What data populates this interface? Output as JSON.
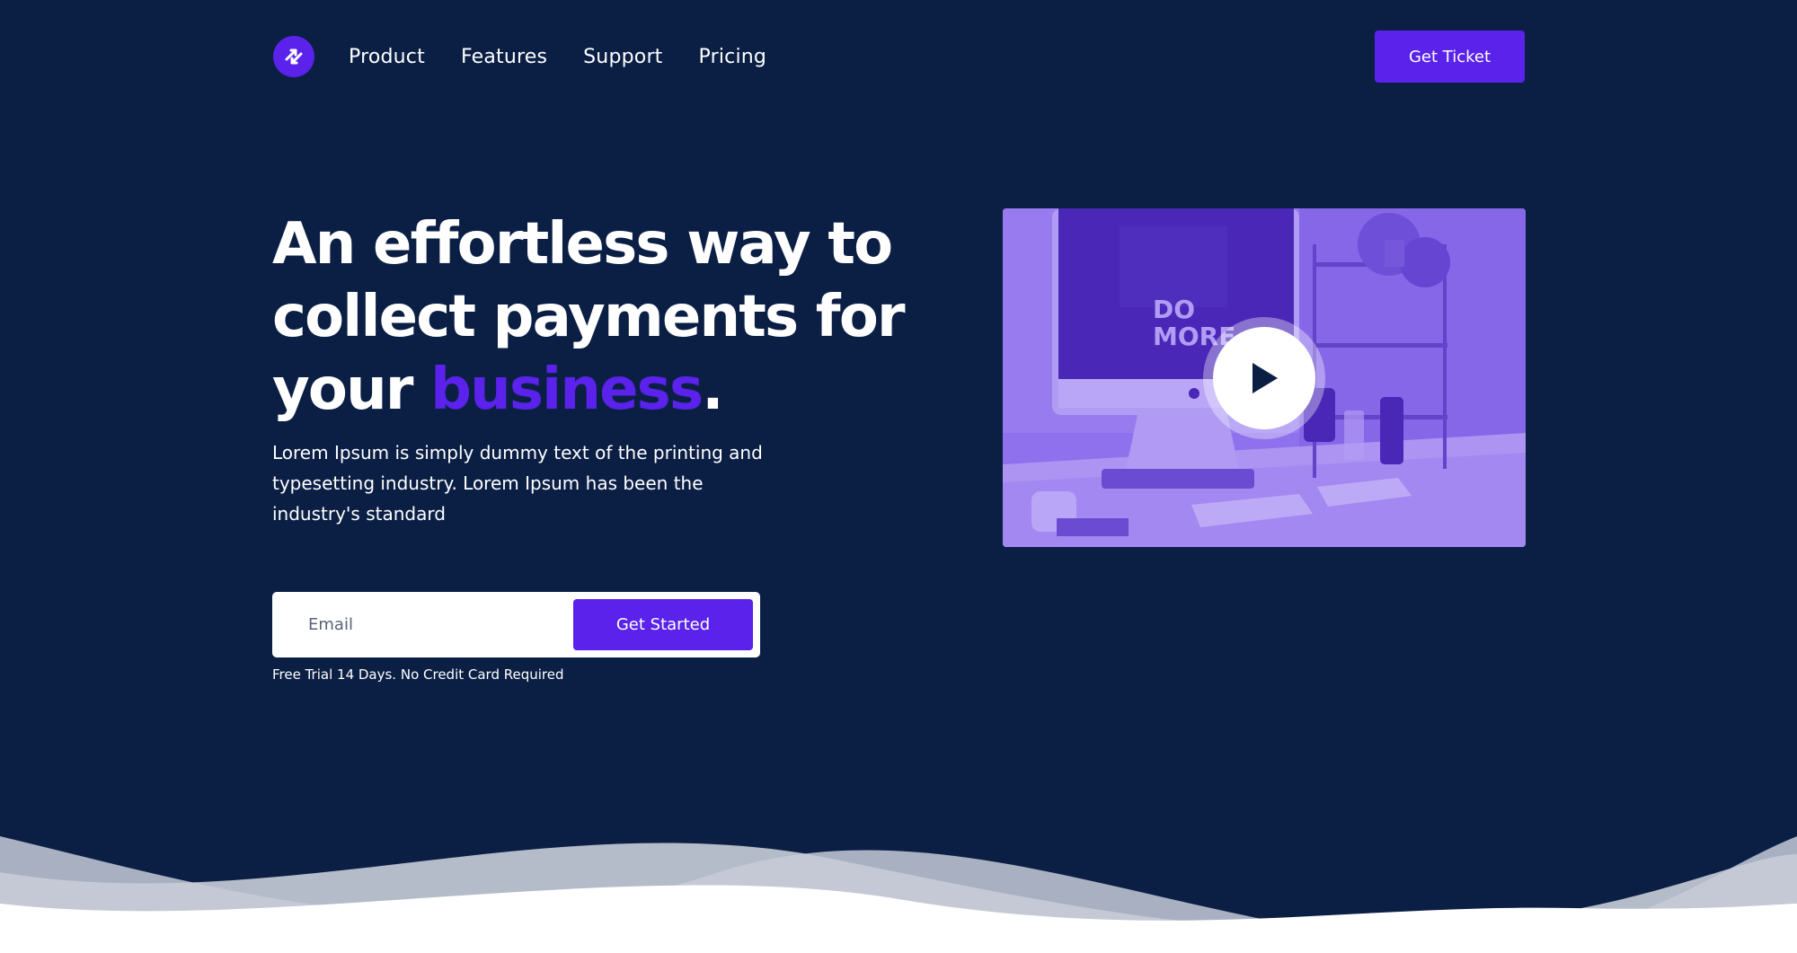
{
  "header": {
    "logo_icon": "exchange-arrows-icon",
    "nav": [
      {
        "label": "Product"
      },
      {
        "label": "Features"
      },
      {
        "label": "Support"
      },
      {
        "label": "Pricing"
      }
    ],
    "cta_label": "Get Ticket"
  },
  "hero": {
    "headline_part1": "An effortless way to collect payments for your ",
    "headline_accent": "business",
    "headline_end": ".",
    "description": "Lorem Ipsum is simply dummy text of the printing and typesetting industry. Lorem Ipsum has been the industry's standard",
    "email_placeholder": "Email",
    "submit_label": "Get Started",
    "trial_note": "Free Trial 14 Days. No Credit Card Required"
  },
  "video": {
    "screen_text_line1": "DO",
    "screen_text_line2": "MORE",
    "play_icon": "play-icon"
  },
  "colors": {
    "background": "#0b1f45",
    "accent": "#5a22ea",
    "video_tint": "#8a6ae6"
  }
}
